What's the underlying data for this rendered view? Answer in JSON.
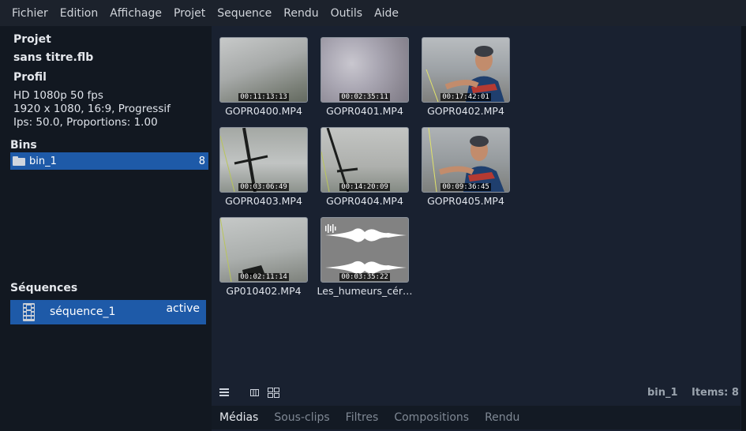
{
  "menu": [
    "Fichier",
    "Edition",
    "Affichage",
    "Projet",
    "Sequence",
    "Rendu",
    "Outils",
    "Aide"
  ],
  "project": {
    "heading": "Projet",
    "file_name": "sans titre.flb",
    "profile_heading": "Profil",
    "profile_line1": "HD 1080p 50 fps",
    "profile_line2": "1920 x 1080, 16:9, Progressif",
    "profile_line3": "Ips: 50.0, Proportions: 1.00"
  },
  "bins": {
    "heading": "Bins",
    "items": [
      {
        "name": "bin_1",
        "count": "8"
      }
    ]
  },
  "sequences": {
    "heading": "Séquences",
    "items": [
      {
        "name": "séquence_1",
        "status": "active"
      }
    ]
  },
  "media": {
    "clips": [
      {
        "name": "GOPR0400.MP4",
        "timecode": "00:11:13:13"
      },
      {
        "name": "GOPR0401.MP4",
        "timecode": "00:02:35:11"
      },
      {
        "name": "GOPR0402.MP4",
        "timecode": "00:17:42:01"
      },
      {
        "name": "GOPR0403.MP4",
        "timecode": "00:03:06:49"
      },
      {
        "name": "GOPR0404.MP4",
        "timecode": "00:14:20:09"
      },
      {
        "name": "GOPR0405.MP4",
        "timecode": "00:09:36:45"
      },
      {
        "name": "GP010402.MP4",
        "timecode": "00:02:11:14"
      },
      {
        "name": "Les_humeurs_cér…",
        "timecode": "00:03:35:22"
      }
    ],
    "current_bin": "bin_1",
    "items_label": "Items: 8"
  },
  "tabs": [
    "Médias",
    "Sous-clips",
    "Filtres",
    "Compositions",
    "Rendu"
  ],
  "colors": {
    "accent": "#1e5aa8",
    "background": "#1e2530"
  }
}
